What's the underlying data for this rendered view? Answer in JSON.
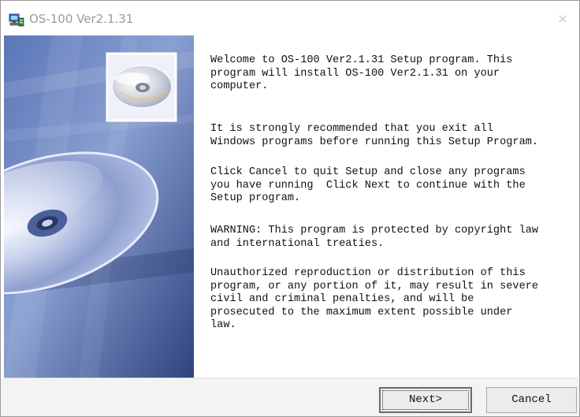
{
  "window": {
    "title": "OS-100 Ver2.1.31",
    "close_glyph": "×",
    "app_icon": "setup-computer-icon"
  },
  "banner": {
    "artwork": "cd-disc-banner",
    "accent_colors": [
      "#4f6fb0",
      "#8fa6d6",
      "#2c3f7e"
    ]
  },
  "content": {
    "paragraphs": [
      "Welcome to OS-100 Ver2.1.31 Setup program. This\nprogram will install OS-100 Ver2.1.31 on your\ncomputer.",
      "It is strongly recommended that you exit all\nWindows programs before running this Setup Program.",
      "Click Cancel to quit Setup and close any programs\nyou have running  Click Next to continue with the\nSetup program.",
      "WARNING: This program is protected by copyright law\nand international treaties.",
      "Unauthorized reproduction or distribution of this\nprogram, or any portion of it, may result in severe\ncivil and criminal penalties, and will be\nprosecuted to the maximum extent possible under\nlaw."
    ]
  },
  "buttons": {
    "next_label": "Next>",
    "cancel_label": "Cancel"
  }
}
